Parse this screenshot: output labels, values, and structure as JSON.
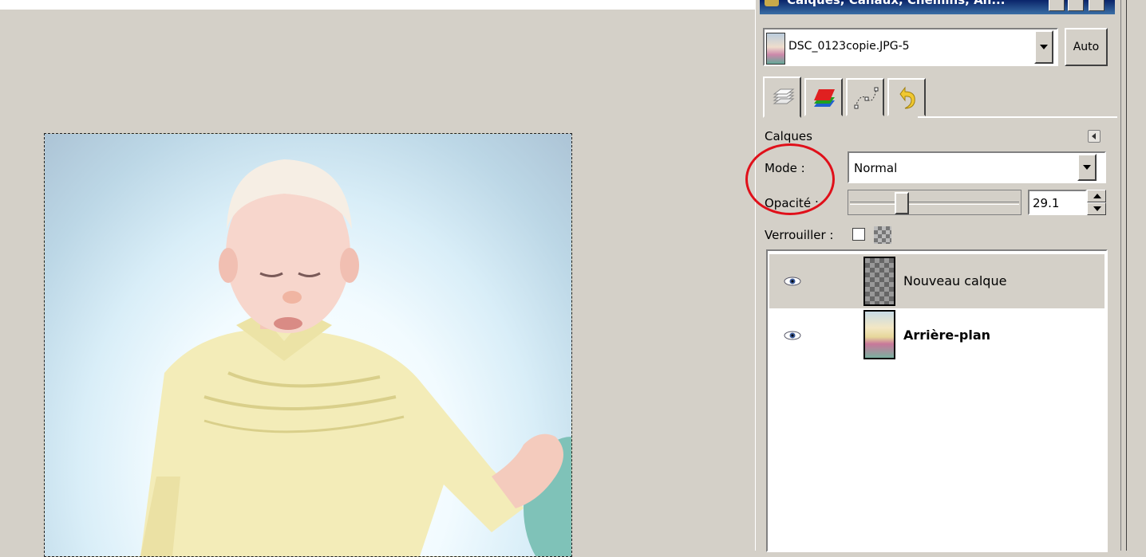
{
  "dock": {
    "title": "Calques, Canaux, Chemins, An...",
    "image_selector": {
      "value": "DSC_0123copie.JPG-5"
    },
    "auto_button": "Auto",
    "tabs": [
      "layers-tab-icon",
      "channels-tab-icon",
      "paths-tab-icon",
      "undo-tab-icon"
    ]
  },
  "layers_panel": {
    "title": "Calques",
    "mode_label": "Mode :",
    "mode_value": "Normal",
    "opacity_label": "Opacité :",
    "opacity_value": "29.1",
    "lock_label": "Verrouiller :",
    "layers": [
      {
        "name": "Nouveau calque",
        "visible": true,
        "selected": true
      },
      {
        "name": "Arrière-plan",
        "visible": true,
        "selected": false
      }
    ]
  },
  "annotation": {
    "color": "#e0101a"
  }
}
